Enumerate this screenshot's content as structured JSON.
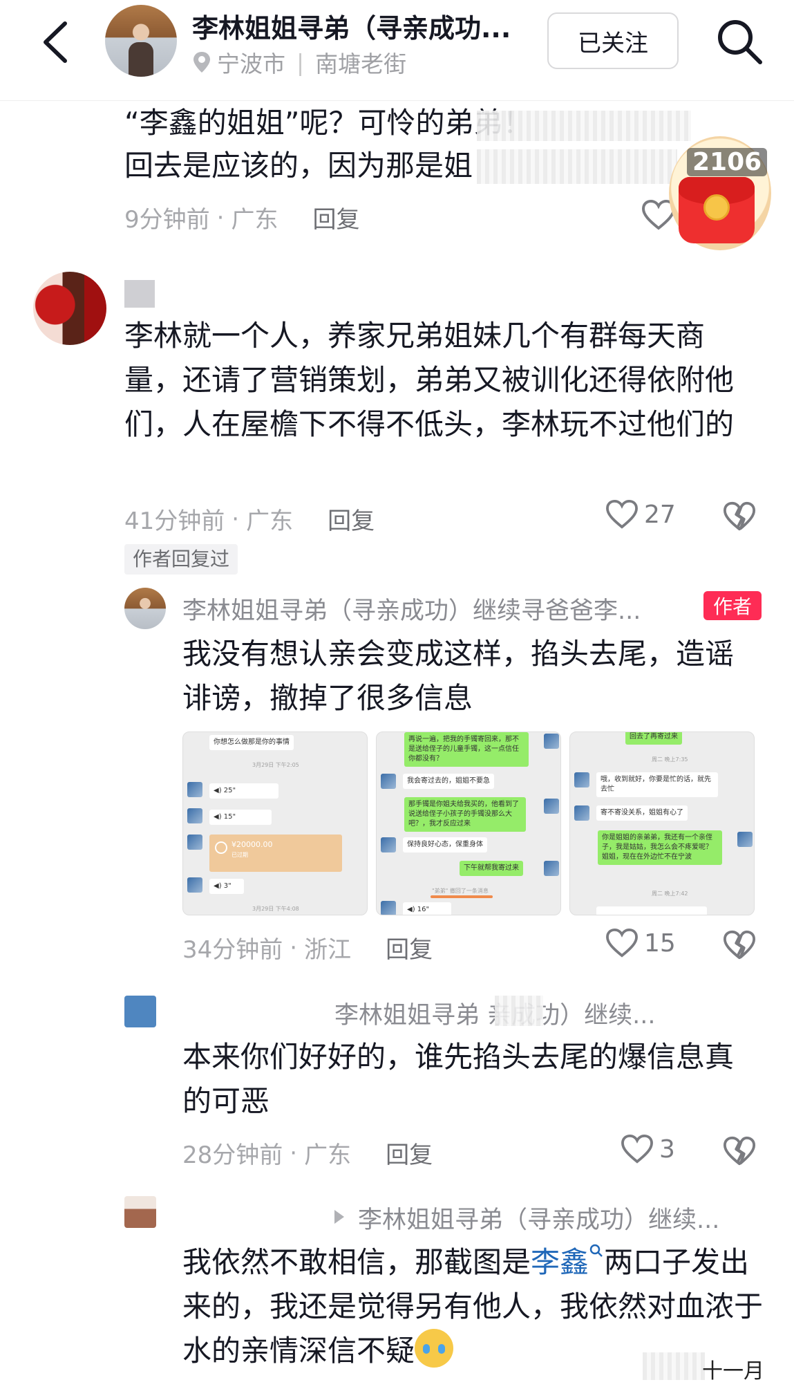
{
  "header": {
    "title": "李林姐姐寻弟（寻亲成功...",
    "location_city": "宁波市",
    "location_place": "南塘老街",
    "follow_label": "已关注"
  },
  "red_packet": {
    "count": "2106"
  },
  "comments": [
    {
      "text_line1": "“李鑫的姐姐”呢？可怜的弟弟！",
      "text_line2": "回去是应该的，因为那是姐",
      "time": "9分钟前",
      "region": "广东",
      "reply_label": "回复"
    },
    {
      "text": "李林就一个人，养家兄弟姐妹几个有群每天商量，还请了营销策划，弟弟又被训化还得依附他们，人在屋檐下不得不低头，李林玩不过他们的",
      "time": "41分钟前",
      "region": "广东",
      "reply_label": "回复",
      "likes": "27",
      "author_replied_tag": "作者回复过"
    }
  ],
  "replies": [
    {
      "name": "李林姐姐寻弟（寻亲成功）继续寻爸爸李...",
      "badge": "作者",
      "text": "我没有想认亲会变成这样，掐头去尾，造谣诽谤，撤掉了很多信息",
      "time": "34分钟前",
      "region": "浙江",
      "reply_label": "回复",
      "likes": "15",
      "screenshots": [
        {
          "date1": "3月29日 下午2:05",
          "msg1": "你想怎么做那是你的事情",
          "voice1": "25\"",
          "voice2": "15\"",
          "transfer": "¥20000.00",
          "transfer_status": "已过期",
          "voice3": "3\"",
          "date2": "3月29日 下午4:08"
        },
        {
          "msg1": "再说一遍，把我的手镯寄回来，那不是送给侄子的儿童手镯，这一点信任你都没有？",
          "msg2": "我会寄过去的，姐姐不要急",
          "msg3": "那手镯是你姐夫给我买的，他看到了说送给侄子小孩子的手镯没那么大吧？，我才反应过来",
          "msg4": "保持良好心态，保重身体",
          "msg5": "下午就帮我寄过来",
          "recall": "\"弟弟\" 撤回了一条消息",
          "voice1": "16\""
        },
        {
          "msg0": "回去了再寄过来",
          "date1": "周二 晚上7:35",
          "msg1": "哦，收到就好，你要是忙的话，就先去忙",
          "msg2": "寄不寄没关系，姐姐有心了",
          "msg3": "你是姐姐的亲弟弟，我还有一个亲侄子，我是姑姑，我怎么会不疼爱呢？姐姐，现在在外边忙不在宁波",
          "date2": "周二 晚上7:42"
        }
      ]
    },
    {
      "name": "李林姐姐寻弟    亲成功）继续...",
      "text": "本来你们好好的，谁先掐头去尾的爆信息真的可恶",
      "time": "28分钟前",
      "region": "广东",
      "reply_label": "回复",
      "likes": "3"
    },
    {
      "name": "李林姐姐寻弟（寻亲成功）继续...",
      "text_before_link": "我依然不敢相信，那截图是",
      "link_text": "李鑫",
      "text_after_link": "两口子发出来的，我还是觉得另有他人，我依然对血浓于水的亲情深信不疑"
    }
  ],
  "watermark": "十一月"
}
